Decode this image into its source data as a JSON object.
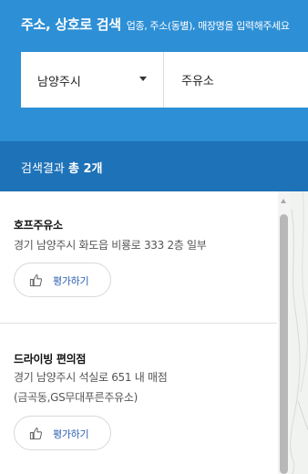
{
  "search": {
    "title": "주소, 상호로 검색",
    "hint": "업종, 주소(동별), 매장명을 입력해주세요",
    "region_value": "남양주시",
    "keyword_value": "주유소"
  },
  "result_summary": {
    "label": "검색결과",
    "count": "총 2개"
  },
  "results": [
    {
      "name": "호프주유소",
      "address": "경기 남양주시 화도읍 비룡로 333 2층 일부",
      "address_extra": "",
      "rate_label": "평가하기"
    },
    {
      "name": "드라이빙 편의점",
      "address": "경기 남양주시 석실로 651 내 매점",
      "address_extra": "(금곡동,GS무대푸른주유소)",
      "rate_label": "평가하기"
    }
  ],
  "colors": {
    "search_panel": "#2d8fd5",
    "result_bar": "#1e72b8",
    "rate_text": "#2b5fb0"
  },
  "icons": {
    "dropdown": "caret-down-icon",
    "rate": "thumbs-up-icon",
    "scroll_up": "arrow-up-icon"
  }
}
